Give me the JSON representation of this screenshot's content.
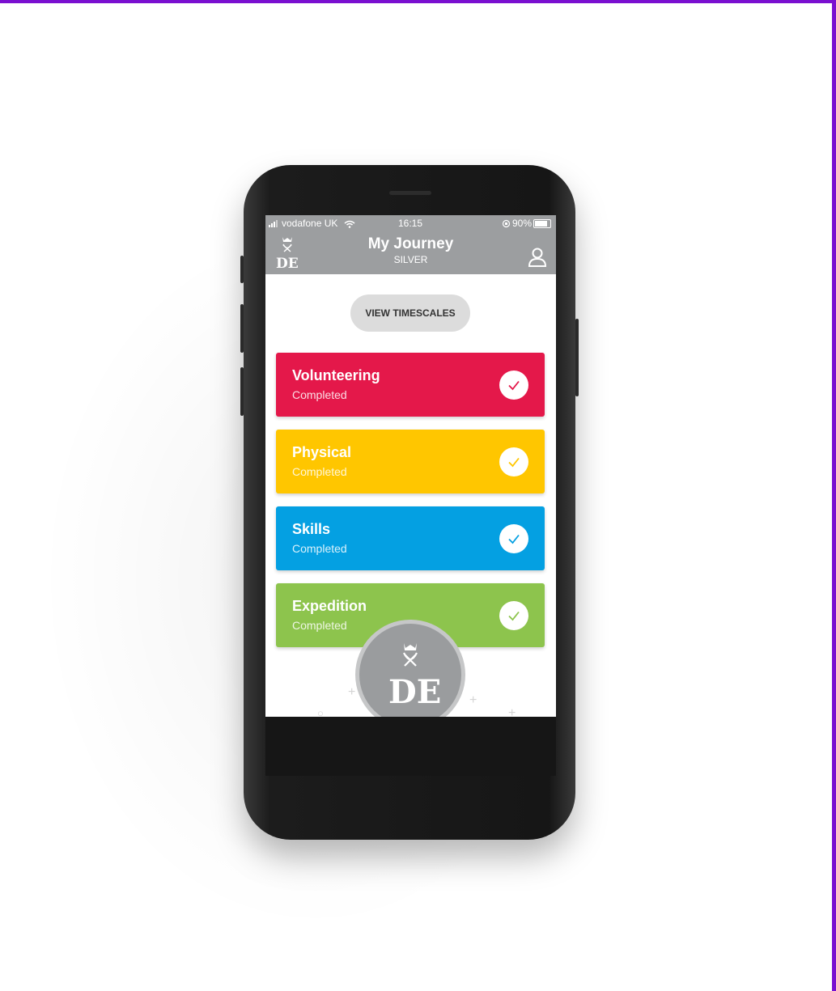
{
  "page": {
    "accent_color": "#7a0fd0"
  },
  "status_bar": {
    "carrier": "vodafone UK",
    "time": "16:15",
    "battery": "90%"
  },
  "header": {
    "title": "My Journey",
    "subtitle": "SILVER",
    "logo_icon": "dofe-logo-icon",
    "profile_icon": "user-profile-icon"
  },
  "timescales_button": {
    "label": "VIEW TIMESCALES"
  },
  "sections": [
    {
      "title": "Volunteering",
      "status": "Completed",
      "color": "#e4184a"
    },
    {
      "title": "Physical",
      "status": "Completed",
      "color": "#ffc600"
    },
    {
      "title": "Skills",
      "status": "Completed",
      "color": "#04a0e2"
    },
    {
      "title": "Expedition",
      "status": "Completed",
      "color": "#8dc44d"
    }
  ],
  "award_badge": {
    "icon": "dofe-award-badge-icon",
    "color": "#9a9c9e"
  }
}
